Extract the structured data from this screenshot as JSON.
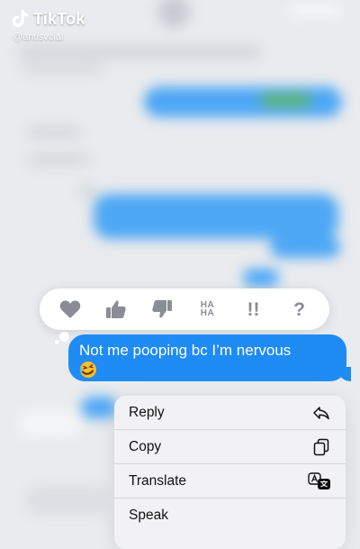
{
  "watermark": {
    "brand": "TikTok",
    "username": "@antisvcial"
  },
  "tapbacks": [
    {
      "icon": "heart-icon"
    },
    {
      "icon": "thumbs-up-icon"
    },
    {
      "icon": "thumbs-down-icon"
    },
    {
      "icon": "haha-icon",
      "text": "HA HA"
    },
    {
      "icon": "exclamation-icon",
      "text": "!!"
    },
    {
      "icon": "question-icon",
      "text": "?"
    }
  ],
  "message": {
    "text": "Not me pooping bc I’m nervous",
    "emoji": "rolling-on-floor-laughing-emoji",
    "color": "#1f8bf5"
  },
  "menu": {
    "items": [
      {
        "label": "Reply",
        "icon": "reply-icon"
      },
      {
        "label": "Copy",
        "icon": "copy-icon"
      },
      {
        "label": "Translate",
        "icon": "translate-icon"
      },
      {
        "label": "Speak",
        "icon": ""
      }
    ]
  }
}
